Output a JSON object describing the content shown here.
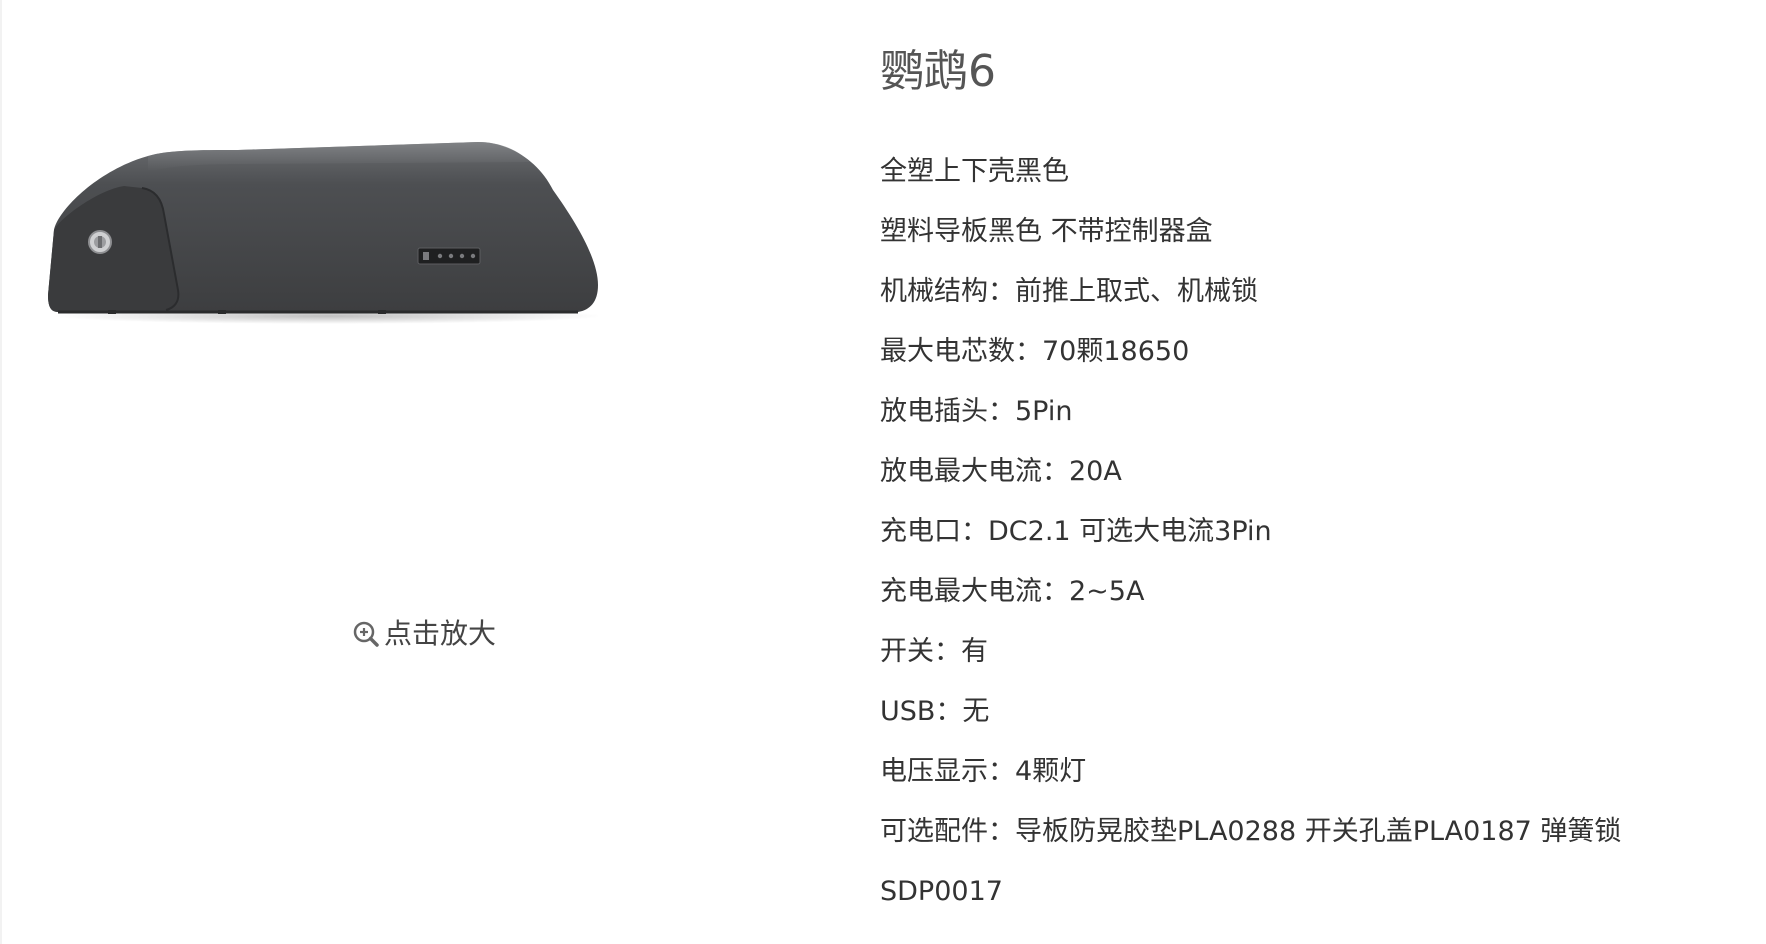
{
  "product": {
    "title": "鹦鹉6",
    "zoom_label": "点击放大",
    "color_body": "#4a4b4d",
    "specs": [
      "全塑上下壳黑色",
      "塑料导板黑色 不带控制器盒",
      "机械结构：前推上取式、机械锁",
      "最大电芯数：70颗18650",
      "放电插头：5Pin",
      "放电最大电流：20A",
      "充电口：DC2.1  可选大电流3Pin",
      "充电最大电流：2~5A",
      "开关：有",
      "USB：无",
      "电压显示：4颗灯",
      "可选配件：导板防晃胶垫PLA0288   开关孔盖PLA0187  弹簧锁 SDP0017"
    ]
  },
  "icons": {
    "zoom": "zoom-in-icon",
    "lock": "lock-icon"
  }
}
